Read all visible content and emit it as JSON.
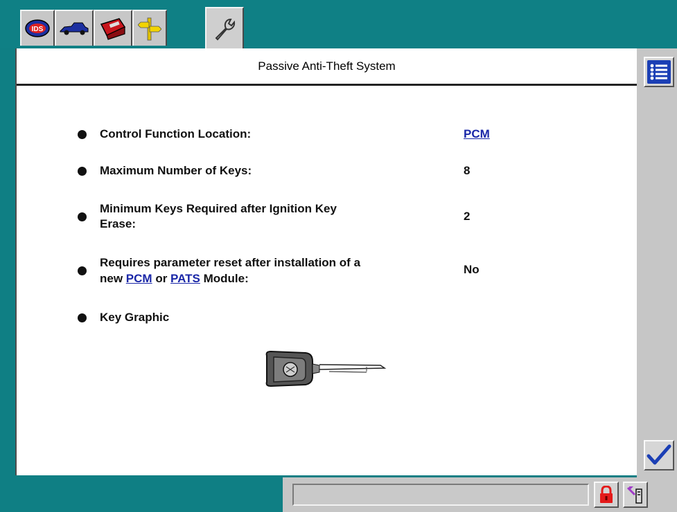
{
  "title": "Passive Anti-Theft System",
  "colors": {
    "background": "#0f7f84",
    "panel": "#ffffff",
    "link": "#1a27a8",
    "toolbar": "#c6c6c6"
  },
  "tabs": [
    {
      "icon": "ids-logo-icon"
    },
    {
      "icon": "vehicle-icon"
    },
    {
      "icon": "toolbox-icon"
    },
    {
      "icon": "signpost-icon"
    },
    {
      "icon": "wrench-icon",
      "active": true
    }
  ],
  "rows": [
    {
      "label": "Control Function Location:",
      "value": "PCM"
    },
    {
      "label": "Maximum Number of Keys:",
      "value": "8"
    },
    {
      "label_line1": "Minimum Keys Required after Ignition Key",
      "label_line2": "Erase:",
      "value": "2"
    },
    {
      "label_line1": "Requires parameter reset after installation of a",
      "label_line2_prefix": "new",
      "link1": "PCM",
      "or_text": "or",
      "link2": "PATS",
      "label_line2_suffix": "Module:",
      "value": "No"
    },
    {
      "label": "Key Graphic"
    }
  ],
  "right_toolbar": [
    {
      "icon": "list-icon"
    },
    {
      "icon": "checkmark-icon"
    }
  ],
  "status_bar": {
    "field_text": "",
    "icons": [
      "lock-icon",
      "connection-icon"
    ]
  }
}
